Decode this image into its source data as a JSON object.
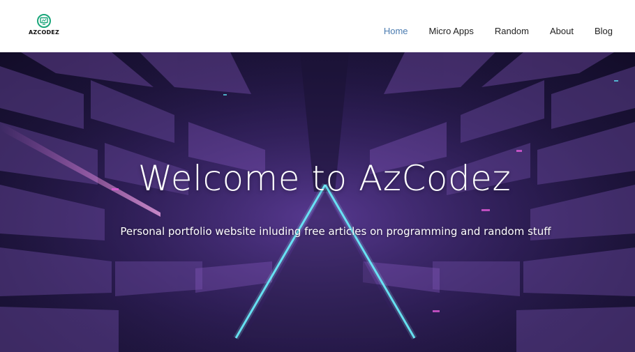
{
  "logo": {
    "text": "AZCODEZ",
    "icon": "monitor-logo-icon",
    "color": "#1aa67a"
  },
  "nav": {
    "items": [
      {
        "label": "Home",
        "active": true
      },
      {
        "label": "Micro Apps",
        "active": false
      },
      {
        "label": "Random",
        "active": false
      },
      {
        "label": "About",
        "active": false
      },
      {
        "label": "Blog",
        "active": false
      }
    ],
    "active_color": "#4a7bb0"
  },
  "hero": {
    "title": "Welcome to AzCodez",
    "subtitle": "Personal portfolio website inluding free articles on programming and random stuff",
    "background_colors": [
      "#2a1c4f",
      "#6a3aa0",
      "#4fe0ff",
      "#e05ad8"
    ]
  }
}
